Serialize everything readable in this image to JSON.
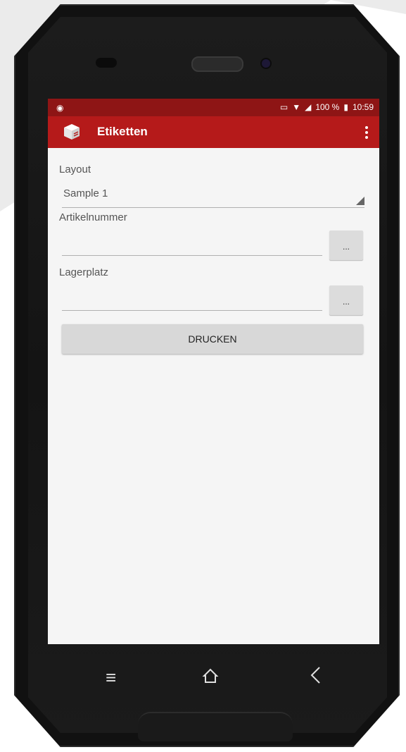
{
  "status_bar": {
    "left_icon": "circle-dot-icon",
    "battery_text": "100 %",
    "time": "10:59"
  },
  "toolbar": {
    "title": "Etiketten",
    "app_icon": "box-icon",
    "menu_icon": "more-vert-icon"
  },
  "form": {
    "layout_label": "Layout",
    "layout_value": "Sample 1",
    "article_label": "Artikelnummer",
    "article_value": "",
    "article_button": "...",
    "storage_label": "Lagerplatz",
    "storage_value": "",
    "storage_button": "...",
    "print_button": "DRUCKEN"
  },
  "nav": {
    "menu_icon": "menu-icon",
    "home_icon": "home-icon",
    "back_icon": "back-icon"
  },
  "colors": {
    "toolbar": "#b51a1a",
    "status_bar": "#8e1515"
  }
}
